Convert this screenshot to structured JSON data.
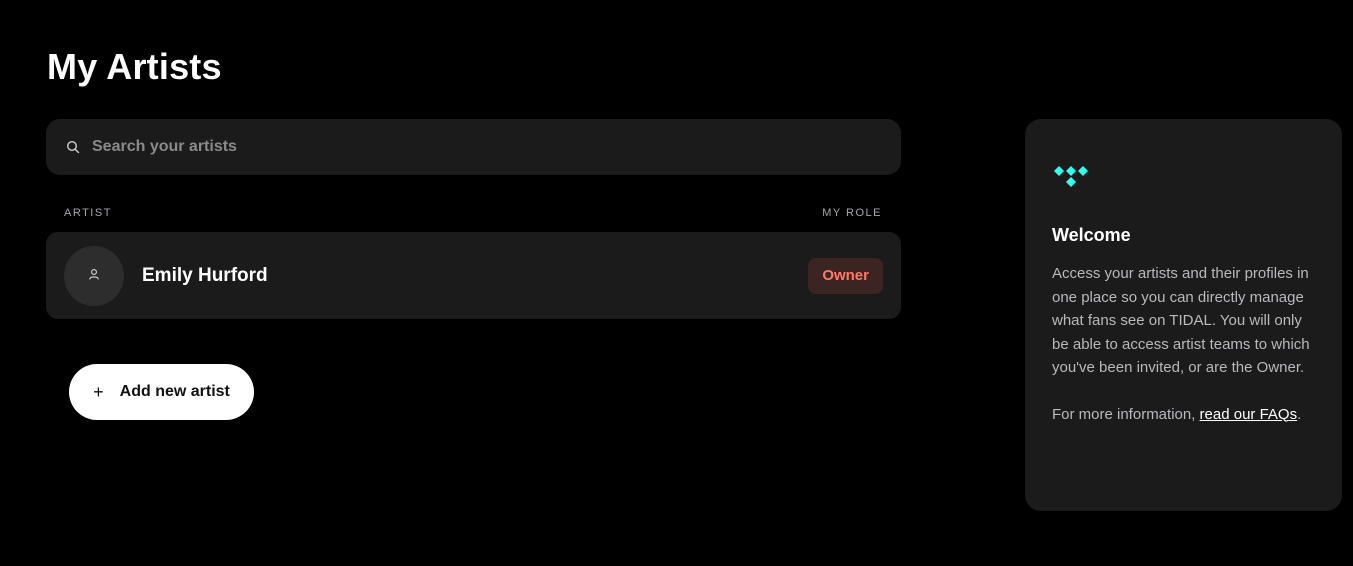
{
  "page": {
    "title": "My Artists"
  },
  "search": {
    "placeholder": "Search your artists",
    "icon": "search-icon"
  },
  "table": {
    "headers": {
      "artist": "ARTIST",
      "role": "MY ROLE"
    },
    "rows": [
      {
        "name": "Emily Hurford",
        "role": "Owner",
        "avatar_icon": "person-icon"
      }
    ]
  },
  "actions": {
    "add_artist_label": "Add new artist",
    "add_icon": "plus-icon"
  },
  "welcome": {
    "logo": "tidal-logo",
    "title": "Welcome",
    "body": "Access your artists and their profiles in one place so you can directly manage what fans see on TIDAL. You will only be able to access artist teams to which you've been invited, or are the Owner.",
    "more_prefix": "For more information, ",
    "link_text": "read our FAQs",
    "more_suffix": "."
  },
  "colors": {
    "background": "#000000",
    "card": "#1b1b1b",
    "accent_logo": "#33ffee",
    "owner_badge_bg": "#3c2422",
    "owner_badge_text": "#ff7a66"
  }
}
